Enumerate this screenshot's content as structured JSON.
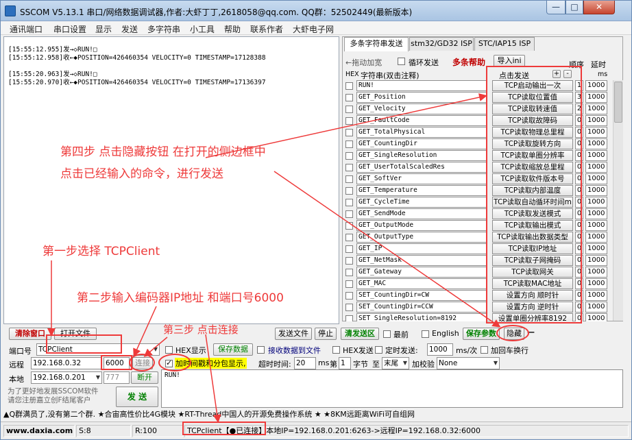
{
  "window": {
    "title": "SSCOM V5.13.1 串口/网络数据调试器,作者:大虾丁丁,2618058@qq.com. QQ群：52502449(最新版本)",
    "min_glyph": "—",
    "max_glyph": "□",
    "close_glyph": "✕"
  },
  "menu": [
    "通讯端口",
    "串口设置",
    "显示",
    "发送",
    "多字符串",
    "小工具",
    "帮助",
    "联系作者",
    "大虾电子网"
  ],
  "receive": {
    "lines": [
      "[15:55:12.955]发→◇RUN!□",
      "[15:55:12.958]收←◆POSITION=426460354 VELOCITY=0 TIMESTAMP=17128388",
      "",
      "[15:55:20.963]发→◇RUN!□",
      "[15:55:20.970]收←◆POSITION=426460354 VELOCITY=0 TIMESTAMP=17136397"
    ]
  },
  "tabs": [
    "多条字符串发送",
    "stm32/GD32 ISP",
    "STC/IAP15 ISP"
  ],
  "multi": {
    "drag_label": "←拖动加宽",
    "loop_label": "循环发送",
    "help_label": "多条帮助",
    "import_label": "导入ini",
    "order_header": "顺序",
    "delay_header": "延时",
    "hex_header": "HEX",
    "str_header": "字符串(双击注释)",
    "click_header": "点击发送",
    "plus": "+",
    "minus": "-",
    "ms_header": "ms",
    "rows": [
      {
        "cmd": "RUN!",
        "label": "TCP启动输出一次",
        "order": "1",
        "delay": "1000"
      },
      {
        "cmd": "GET_Position",
        "label": "TCP读取位置值",
        "order": "3",
        "delay": "1000"
      },
      {
        "cmd": "GET_Velocity",
        "label": "TCP读取转速值",
        "order": "2",
        "delay": "1000"
      },
      {
        "cmd": "GET_FaultCode",
        "label": "TCP读取故障码",
        "order": "0",
        "delay": "1000"
      },
      {
        "cmd": "GET_TotalPhysical",
        "label": "TCP读取物理总里程",
        "order": "0",
        "delay": "1000"
      },
      {
        "cmd": "GET_CountingDir",
        "label": "TCP读取旋转方向",
        "order": "0",
        "delay": "1000"
      },
      {
        "cmd": "GET_SingleResolution",
        "label": "TCP读取单圈分辨率",
        "order": "0",
        "delay": "1000"
      },
      {
        "cmd": "GET_UserTotalScaledRes",
        "label": "TCP读取缩放总里程",
        "order": "0",
        "delay": "1000"
      },
      {
        "cmd": "GET_SoftVer",
        "label": "TCP读取软件版本号",
        "order": "0",
        "delay": "1000"
      },
      {
        "cmd": "GET_Temperature",
        "label": "TCP读取内部温度",
        "order": "0",
        "delay": "1000"
      },
      {
        "cmd": "GET_CycleTime",
        "label": "TCP读取自动循环时间m",
        "order": "0",
        "delay": "1000"
      },
      {
        "cmd": "GET_SendMode",
        "label": "TCP读取发送模式",
        "order": "0",
        "delay": "1000"
      },
      {
        "cmd": "GET_OutputMode",
        "label": "TCP读取输出模式",
        "order": "0",
        "delay": "1000"
      },
      {
        "cmd": "GET_OutputType",
        "label": "TCP读取输出数据类型",
        "order": "0",
        "delay": "1000"
      },
      {
        "cmd": "GET_IP",
        "label": "TCP读取IP地址",
        "order": "0",
        "delay": "1000"
      },
      {
        "cmd": "GET_NetMask",
        "label": "TCP读取子网掩码",
        "order": "0",
        "delay": "1000"
      },
      {
        "cmd": "GET_Gateway",
        "label": "TCP读取网关",
        "order": "0",
        "delay": "1000"
      },
      {
        "cmd": "GET_MAC",
        "label": "TCP读取MAC地址",
        "order": "0",
        "delay": "1000"
      },
      {
        "cmd": "SET_CountingDir=CW",
        "label": "设置方向 顺时针",
        "order": "0",
        "delay": "1000"
      },
      {
        "cmd": "SET_CountingDir=CCW",
        "label": "设置方向 逆时针",
        "order": "0",
        "delay": "1000"
      },
      {
        "cmd": "SET_SingleResolution=8192",
        "label": "设置单圈分辨率8192",
        "order": "0",
        "delay": "1000"
      }
    ]
  },
  "controls": {
    "clear_window": "清除窗口",
    "open_file": "打开文件",
    "send_file": "发送文件",
    "stop": "停止",
    "clear_send": "清发送区",
    "frontmost": "最前",
    "english": "English",
    "save_params": "保存参数",
    "hide": "隐藏",
    "dash": "—",
    "port_label": "端口号",
    "port_value": "TCPClient",
    "hex_display": "HEX显示",
    "save_data": "保存数据",
    "recv_to_file": "接收数据到文件",
    "hex_send": "HEX发送",
    "timed_send": "定时发送:",
    "timed_value": "1000",
    "ms_per": "ms/次",
    "add_crlf": "加回车换行",
    "remote_label": "远程",
    "remote_ip": "192.168.0.32",
    "remote_port": "6000",
    "connect": "连接",
    "timestamp_label": "加时间戳和分包显示,",
    "timeout_label": "超时时间:",
    "timeout_value": "20",
    "ms": "ms",
    "nth_label": "第",
    "nth_value": "1",
    "byte_label": "字节",
    "to_label": "至",
    "tail_value": "末尾",
    "checksum_label": "加校验",
    "checksum_value": "None",
    "local_label": "本地",
    "local_ip": "192.168.0.201",
    "local_port": "777",
    "disconnect": "断开",
    "promo": "为了更好地发展SSCOM软件\n请您注册嘉立创F结尾客户",
    "send": "发 送",
    "send_text": "RUN!"
  },
  "adbar": "▲Q群满员了,没有第二个群. ★合宙高性价比4G模块 ★RT-Thread中国人的开源免费操作系统 ★ ★8KM远距离WiFi可自组网",
  "status": {
    "site": "www.daxia.com",
    "sent": "S:8",
    "recv": "R:100",
    "conn_prefix": "TCPclient",
    "conn_state": "【●已连接】",
    "conn_info": "本地IP=192.168.0.201:6263->远程IP=192.168.0.32:6000"
  },
  "annotations": {
    "step4_line1": "第四步 点击隐藏按钮 在打开的侧边框中",
    "step4_line2": "点击已经输入的命令，进行发送",
    "step1": "第一步选择 TCPClient",
    "step2": "第二步输入编码器IP地址 和端口号6000",
    "step3": "第三步 点击连接"
  },
  "colors": {
    "annotation": "#ee3a3a",
    "help_red": "#c00000",
    "connected_green": "#008000"
  }
}
